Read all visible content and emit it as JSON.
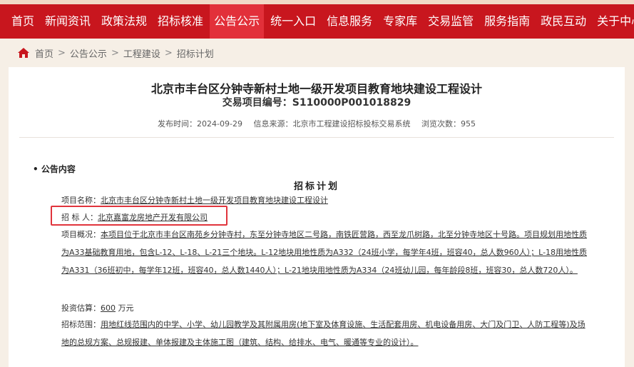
{
  "nav": {
    "items": [
      "首页",
      "新闻资讯",
      "政策法规",
      "招标核准",
      "公告公示",
      "统一入口",
      "信息服务",
      "专家库",
      "交易监管",
      "服务指南",
      "政民互动",
      "关于中心"
    ],
    "active": "公告公示"
  },
  "breadcrumb": {
    "home_icon": "home-icon",
    "items": [
      "首页",
      "公告公示",
      "工程建设",
      "招标计划"
    ],
    "separator": ">"
  },
  "article": {
    "title": "北京市丰台区分钟寺新村土地一级开发项目教育地块建设工程设计",
    "project_no": "交易项目编号：S110000P001018829",
    "meta": {
      "publish_time": "发布时间：2024-09-29",
      "source": "信息来源：北京市工程建设招标投标交易系统",
      "views": "浏览次数：955"
    },
    "section_heading": "• 公告内容",
    "plan_title": "招标计划",
    "fields": {
      "project_name_label": "项目名称：",
      "project_name": "北京市丰台区分钟寺新村土地一级开发项目教育地块建设工程设计",
      "tenderer_label": "招 标 人：",
      "tenderer": "北京嘉富龙房地产开发有限公司",
      "overview_label": "项目概况：",
      "overview": "本项目位于北京市丰台区南苑乡分钟寺村，东至分钟寺地区二号路，南铁匠营路，西至龙爪树路，北至分钟寺地区十号路。项目规划用地性质为A33基础教育用地，包含L-12、L-18、L-21三个地块。L-12地块用地性质为A332（24班小学，每学年4班，班容40，总人数960人）；L-18用地性质为A331（36班初中，每学年12班，班容40，总人数1440人）；L-21地块用地性质为A334（24班幼儿园，每年龄段8班，班容30，总人数720人）。",
      "investment_label": "投资估算：",
      "investment": "600",
      "investment_unit": "万元",
      "scope_label": "招标范围：",
      "scope": "用地红线范围内的中学、小学、幼儿园教学及其附属用房(地下室及体育设施、生活配套用房、机电设备用房、大门及门卫、人防工程等)及场地的总规方案、总规报建、单体报建及主体施工图（建筑、结构、给排水、电气、暖通等专业的设计）。"
    }
  },
  "colors": {
    "nav_bg": "#c8161e",
    "nav_active": "#e2303a",
    "highlight": "#e0343c"
  }
}
